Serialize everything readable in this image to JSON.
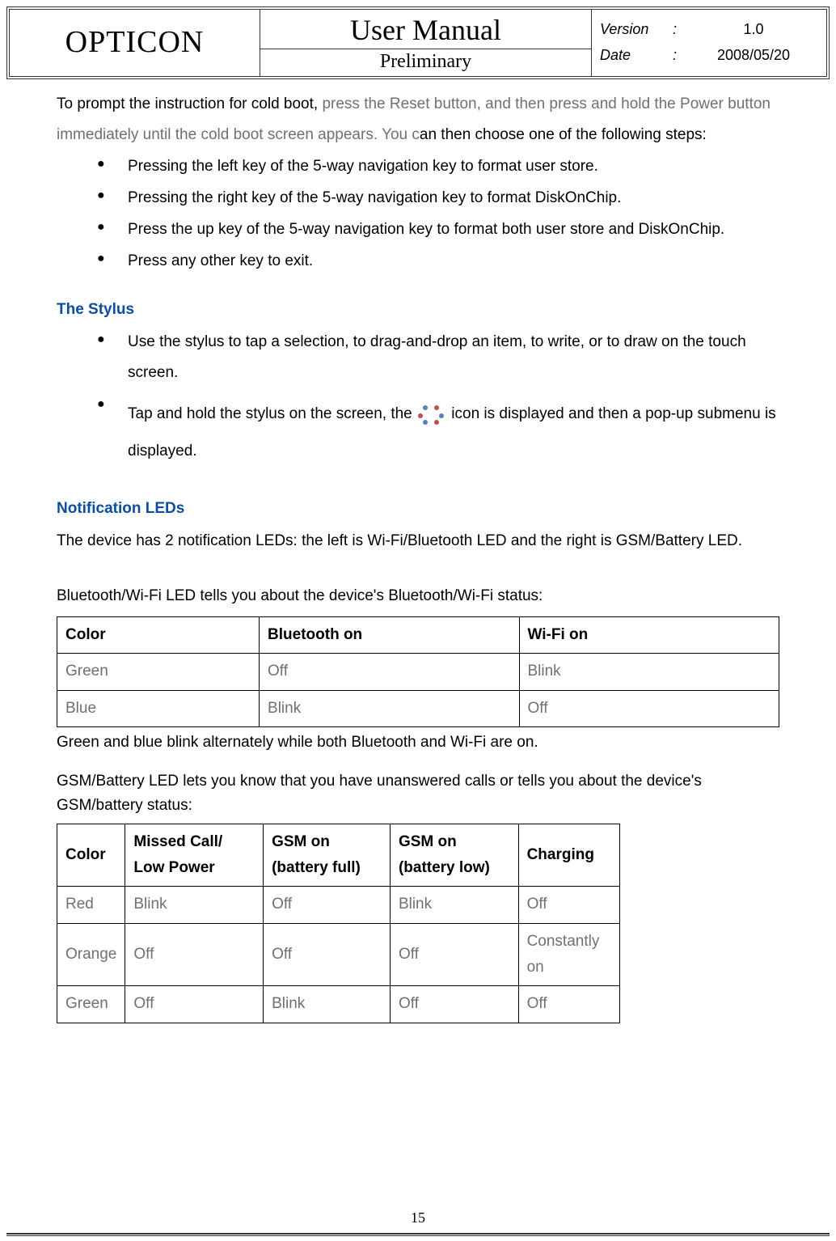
{
  "header": {
    "brand": "OPTICON",
    "title": "User Manual",
    "subtitle": "Preliminary",
    "version_label": "Version",
    "version_value": "1.0",
    "date_label": "Date",
    "date_value": "2008/05/20",
    "colon": ":"
  },
  "intro": {
    "part1": "To prompt the instruction for cold boot, ",
    "part2": "press the Reset button, and then press and hold the Power button immediately until the cold boot screen appears. You c",
    "part3": "an then choose one of the following steps:"
  },
  "coldboot_bullets": [
    "Pressing the left key of the 5-way navigation key to format user store.",
    "Pressing the right key of the 5-way navigation key to format DiskOnChip.",
    "Press the up key of the 5-way navigation key to format both user store and DiskOnChip.",
    "Press any other key to exit."
  ],
  "stylus": {
    "heading": "The Stylus",
    "bullet1": "Use the stylus to tap a selection, to drag-and-drop an item, to write, or to draw on the touch screen.",
    "bullet2a": "Tap and hold the stylus on the screen, the ",
    "bullet2b": " icon is displayed and then a pop-up submenu is displayed."
  },
  "leds": {
    "heading": "Notification LEDs",
    "intro": "The device has 2 notification LEDs: the left is Wi-Fi/Bluetooth LED and the right is GSM/Battery LED.",
    "bt_intro": "Bluetooth/Wi-Fi LED tells you about the device's Bluetooth/Wi-Fi status:",
    "bt_table": {
      "headers": [
        "Color",
        "Bluetooth on",
        "Wi-Fi on"
      ],
      "rows": [
        [
          "Green",
          "Off",
          "Blink"
        ],
        [
          "Blue",
          "Blink",
          "Off"
        ]
      ]
    },
    "bt_note": "Green and blue blink alternately while both Bluetooth and Wi-Fi are on.",
    "gsm_intro": "GSM/Battery LED lets you know that you have unanswered calls or tells you about the device's GSM/battery status:",
    "gsm_table": {
      "headers": [
        "Color",
        "Missed Call/ Low Power",
        "GSM on (battery full)",
        "GSM on (battery low)",
        "Charging"
      ],
      "rows": [
        [
          "Red",
          "Blink",
          "Off",
          "Blink",
          "Off"
        ],
        [
          "Orange",
          "Off",
          "Off",
          "Off",
          "Constantly on"
        ],
        [
          "Green",
          "Off",
          "Blink",
          "Off",
          "Off"
        ]
      ]
    }
  },
  "page_number": "15",
  "icon_colors": {
    "blue": "#5a7fb8",
    "red": "#c05050"
  }
}
